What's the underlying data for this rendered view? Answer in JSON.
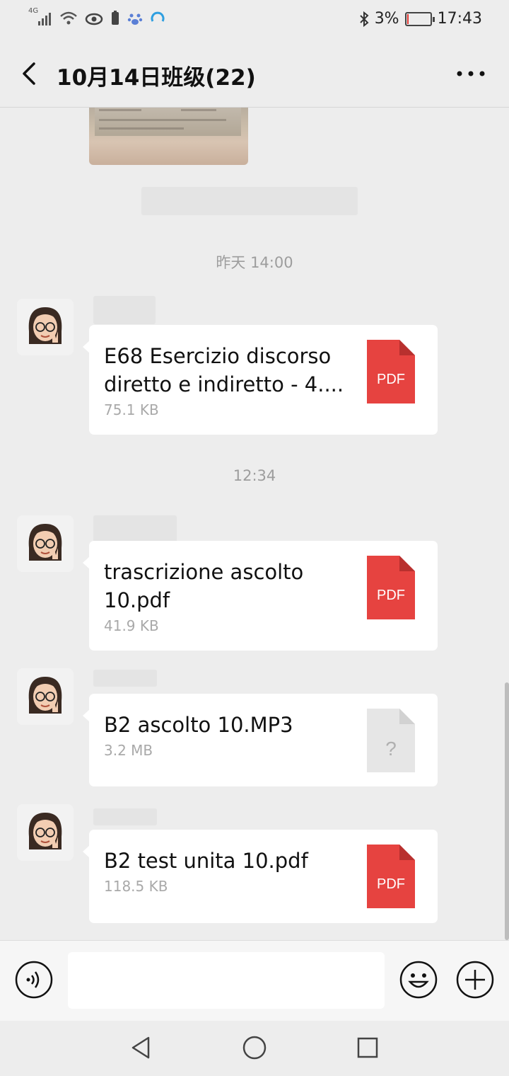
{
  "status_bar": {
    "network": "4G",
    "battery": "3%",
    "battery_level": 0.03,
    "time": "17:43",
    "icons": [
      "signal-icon",
      "wifi-icon",
      "eye-icon",
      "battery-saver-icon",
      "baidu-icon",
      "loading-icon",
      "bluetooth-icon",
      "battery-icon"
    ]
  },
  "nav": {
    "title": "10月14日班级(22)",
    "back_icon": "back-arrow-icon",
    "more_icon": "more-dots-icon"
  },
  "timestamps": [
    "昨天 14:00",
    "12:34"
  ],
  "messages": [
    {
      "file_name": "E68 Esercizio discorso diretto e indiretto - 4....",
      "size": "75.1 KB",
      "file_type": "PDF",
      "icon": "pdf-file-icon"
    },
    {
      "file_name": "trascrizione ascolto 10.pdf",
      "size": "41.9 KB",
      "file_type": "PDF",
      "icon": "pdf-file-icon"
    },
    {
      "file_name": "B2 ascolto 10.MP3",
      "size": "3.2 MB",
      "file_type": "?",
      "icon": "unknown-file-icon"
    },
    {
      "file_name": "B2 test unita 10.pdf",
      "size": "118.5 KB",
      "file_type": "PDF",
      "icon": "pdf-file-icon"
    }
  ],
  "input_bar": {
    "value": "",
    "voice_icon": "voice-icon",
    "emoji_icon": "emoji-icon",
    "plus_icon": "plus-icon"
  },
  "system_nav": [
    "back-triangle-icon",
    "home-circle-icon",
    "recents-square-icon"
  ],
  "colors": {
    "background": "#ededed",
    "bubble": "#ffffff",
    "pdf_red": "#e64340",
    "timestamp": "#9d9d9d",
    "file_size": "#a9a9a9"
  }
}
